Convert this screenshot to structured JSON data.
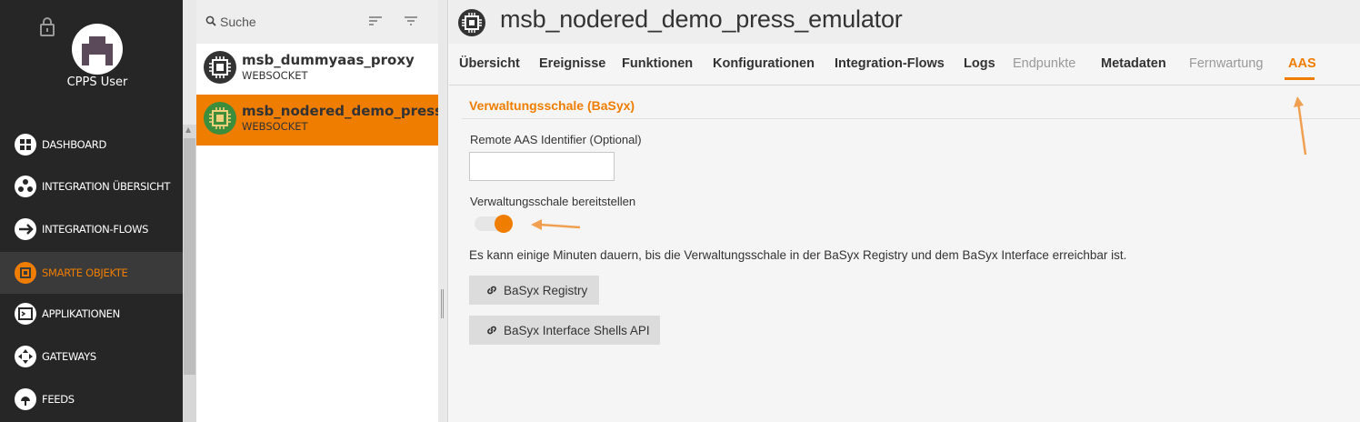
{
  "user": {
    "name": "CPPS User"
  },
  "nav": {
    "items": [
      {
        "label": "DASHBOARD",
        "icon": "dashboard-icon",
        "active": false
      },
      {
        "label": "INTEGRATION ÜBERSICHT",
        "icon": "integration-overview-icon",
        "active": false
      },
      {
        "label": "INTEGRATION-FLOWS",
        "icon": "integration-flows-icon",
        "active": false
      },
      {
        "label": "SMARTE OBJEKTE",
        "icon": "smart-objects-icon",
        "active": true
      },
      {
        "label": "APPLIKATIONEN",
        "icon": "applications-icon",
        "active": false
      },
      {
        "label": "GATEWAYS",
        "icon": "gateways-icon",
        "active": false
      },
      {
        "label": "FEEDS",
        "icon": "feeds-icon",
        "active": false
      }
    ]
  },
  "search": {
    "placeholder": "Suche"
  },
  "list": {
    "items": [
      {
        "title": "msb_dummyaas_proxy",
        "subtitle": "WEBSOCKET",
        "selected": false
      },
      {
        "title": "msb_nodered_demo_press_emulator",
        "subtitle": "WEBSOCKET",
        "selected": true
      }
    ]
  },
  "header": {
    "title": "msb_nodered_demo_press_emulator"
  },
  "tabs": [
    {
      "label": "Übersicht",
      "state": "normal"
    },
    {
      "label": "Ereignisse",
      "state": "normal"
    },
    {
      "label": "Funktionen",
      "state": "normal"
    },
    {
      "label": "Konfigurationen",
      "state": "normal"
    },
    {
      "label": "Integration-Flows",
      "state": "normal"
    },
    {
      "label": "Logs",
      "state": "normal"
    },
    {
      "label": "Endpunkte",
      "state": "disabled"
    },
    {
      "label": "Metadaten",
      "state": "normal"
    },
    {
      "label": "Fernwartung",
      "state": "disabled"
    },
    {
      "label": "AAS",
      "state": "active"
    }
  ],
  "aas": {
    "section_title": "Verwaltungsschale (BaSyx)",
    "remote_label": "Remote AAS Identifier (Optional)",
    "remote_value": "",
    "toggle_label": "Verwaltungsschale bereitstellen",
    "toggle_on": true,
    "info": "Es kann einige Minuten dauern, bis die Verwaltungsschale in der BaSyx Registry und dem BaSyx Interface erreichbar ist.",
    "btn_registry": "BaSyx Registry",
    "btn_shells": "BaSyx Interface Shells API"
  },
  "colors": {
    "accent": "#ef7d00",
    "nav_bg": "#262626",
    "annotation": "#f0a050"
  }
}
